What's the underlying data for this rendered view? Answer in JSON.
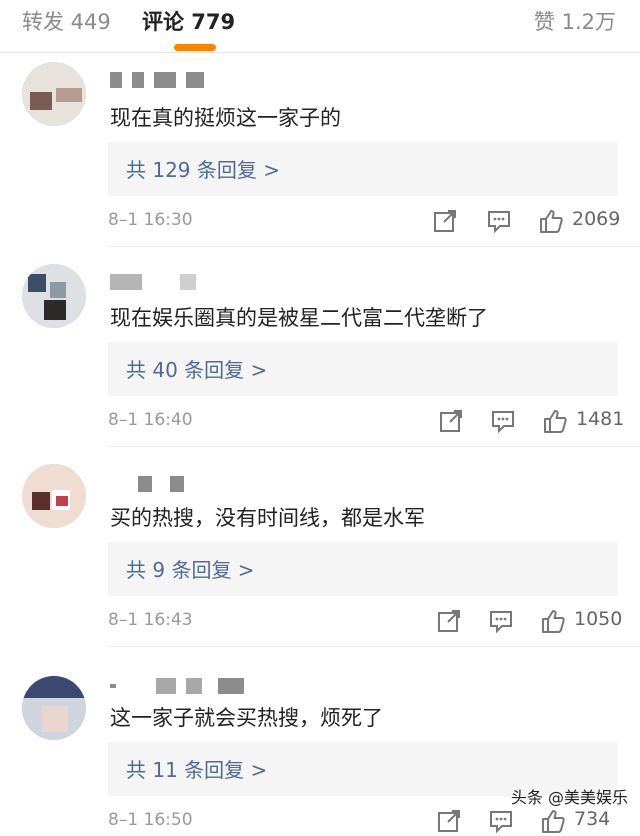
{
  "tabs": {
    "repost": "转发 449",
    "comments": "评论 779",
    "likes": "赞 1.2万"
  },
  "comments": [
    {
      "text": "现在真的挺烦这一家子的",
      "replies": "共 129 条回复 >",
      "time": "8–1 16:30",
      "likes": "2069"
    },
    {
      "text": "现在娱乐圈真的是被星二代富二代垄断了",
      "replies": "共 40 条回复 >",
      "time": "8–1 16:40",
      "likes": "1481"
    },
    {
      "text": "买的热搜，没有时间线，都是水军",
      "replies": "共 9 条回复 >",
      "time": "8–1 16:43",
      "likes": "1050"
    },
    {
      "text": "这一家子就会买热搜，烦死了",
      "replies": "共 11 条回复 >",
      "time": "8–1 16:50",
      "likes": "734"
    }
  ],
  "icons": {
    "share": "share-icon",
    "comment": "comment-icon",
    "like": "thumbs-up-icon"
  },
  "colors": {
    "accent": "#ff8200",
    "link": "#506a95",
    "muted": "#9a9a9a"
  },
  "watermark": "头条 @美美娱乐"
}
